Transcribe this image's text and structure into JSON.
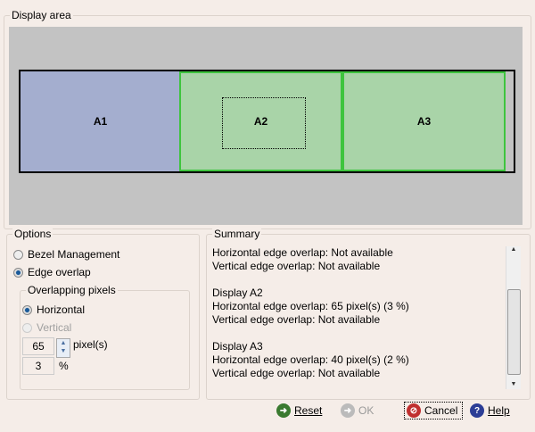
{
  "display_area": {
    "label": "Display area",
    "displays": [
      {
        "name": "A1",
        "color": "#a4aecf"
      },
      {
        "name": "A2",
        "color": "#a9d4a8"
      },
      {
        "name": "A3",
        "color": "#a9d4a8"
      }
    ]
  },
  "options": {
    "label": "Options",
    "bezel": "Bezel Management",
    "edge": "Edge overlap",
    "overlap_label": "Overlapping pixels",
    "horizontal": "Horizontal",
    "vertical": "Vertical",
    "pixels_value": "65",
    "pixels_unit": "pixel(s)",
    "percent_value": "3",
    "percent_unit": "%"
  },
  "summary": {
    "label": "Summary",
    "lines": [
      "Horizontal edge overlap: Not available",
      "Vertical edge overlap: Not available",
      "",
      "Display A2",
      "Horizontal edge overlap: 65 pixel(s) (3 %)",
      "Vertical edge overlap: Not available",
      "",
      "Display A3",
      "Horizontal edge overlap: 40 pixel(s) (2 %)",
      "Vertical edge overlap: Not available"
    ]
  },
  "buttons": {
    "reset": "Reset",
    "ok": "OK",
    "cancel": "Cancel",
    "help": "Help"
  }
}
